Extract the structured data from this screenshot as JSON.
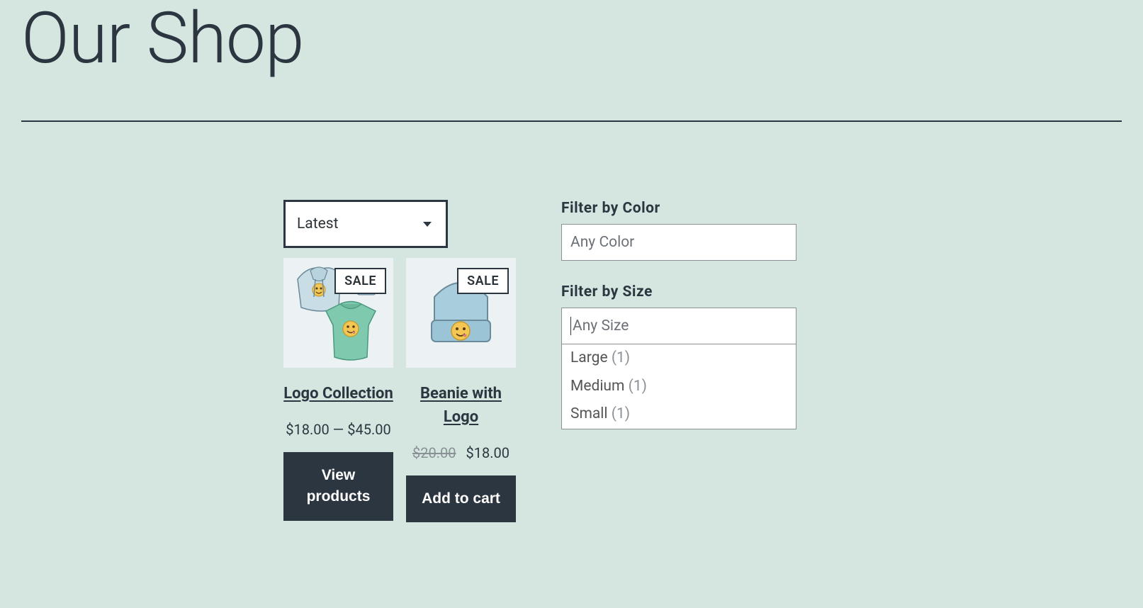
{
  "header": {
    "title": "Our Shop"
  },
  "sort": {
    "selected": "Latest"
  },
  "products": [
    {
      "badge": "SALE",
      "title": "Logo Collection",
      "price_text": "$18.00 — $45.00",
      "button": "View products"
    },
    {
      "badge": "SALE",
      "title": "Beanie with Logo",
      "old_price": "$20.00",
      "price": "$18.00",
      "button": "Add to cart"
    }
  ],
  "filters": {
    "color": {
      "label": "Filter by Color",
      "placeholder": "Any Color"
    },
    "size": {
      "label": "Filter by Size",
      "placeholder": "Any Size",
      "options": [
        {
          "name": "Large",
          "count": "(1)"
        },
        {
          "name": "Medium",
          "count": "(1)"
        },
        {
          "name": "Small",
          "count": "(1)"
        }
      ]
    }
  }
}
